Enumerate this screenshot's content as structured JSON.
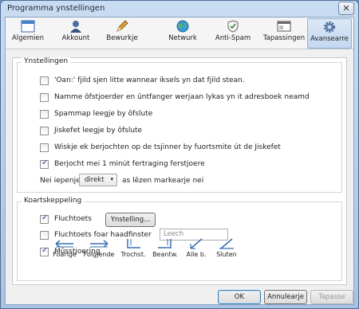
{
  "window": {
    "title": "Programma ynstellingen",
    "close_glyph": "✕"
  },
  "toolbar": [
    {
      "name": "algemien",
      "label": "Algemien",
      "icon": "window-icon",
      "active": false
    },
    {
      "name": "akkount",
      "label": "Akkount",
      "icon": "person-icon",
      "active": false
    },
    {
      "name": "bewurkje",
      "label": "Bewurkje",
      "icon": "pencil-icon",
      "active": false
    },
    {
      "name": "netwurk",
      "label": "Netwurk",
      "icon": "globe-icon",
      "active": false
    },
    {
      "name": "anti-spam",
      "label": "Anti-Spam",
      "icon": "shield-icon",
      "active": false
    },
    {
      "name": "tapassingen",
      "label": "Tapassingen",
      "icon": "app-icon",
      "active": false
    },
    {
      "name": "avansearre",
      "label": "Avansearre",
      "icon": "gear-icon",
      "active": true
    }
  ],
  "settings": {
    "legend": "Ynstellingen",
    "options": [
      {
        "label": "'Oan:' fjild sjen litte wannear iksels yn dat fjild stean.",
        "checked": false
      },
      {
        "label": "Namme ôfstjoerder en ûntfanger werjaan lykas yn it adresboek neamd",
        "checked": false
      },
      {
        "label": "Spammap leegje by ôfslute",
        "checked": false
      },
      {
        "label": "Jiskefet leegje by ôfslute",
        "checked": false
      },
      {
        "label": "Wiskje ek berjochten op de tsjinner by fuortsmite út de Jiskefet",
        "checked": false
      },
      {
        "label": "Berjocht mei 1 minút fertraging ferstjoere",
        "checked": true
      }
    ],
    "open_prefix": "Nei iepenje",
    "open_value": "direkt",
    "open_suffix": "as lêzen markearje nei"
  },
  "shortcuts": {
    "legend": "Koartskeppeling",
    "fluchtoets": {
      "label": "Fluchtoets",
      "checked": true
    },
    "ynstelling_button": "Ynstelling...",
    "foar_haadfinster": {
      "label": "Fluchtoets foar haadfinster",
      "checked": false
    },
    "leech_placeholder": "Leech",
    "mustsjoering": {
      "label": "Mûsstjoering",
      "checked": true
    },
    "gestures": [
      {
        "name": "foarige",
        "label": "Foarige",
        "icon": "arrow-left-icon"
      },
      {
        "name": "folgjende",
        "label": "Folgjende",
        "icon": "arrow-right-icon"
      },
      {
        "name": "trochst",
        "label": "Trochst.",
        "icon": "arrow-down-left-icon"
      },
      {
        "name": "beantw",
        "label": "Beantw.",
        "icon": "arrow-down-right-icon"
      },
      {
        "name": "alle-b",
        "label": "Alle b.",
        "icon": "arrow-diagonal-icon"
      },
      {
        "name": "sluten",
        "label": "Sluten",
        "icon": "arrow-close-icon"
      }
    ]
  },
  "buttons": {
    "ok": "OK",
    "cancel": "Annulearje",
    "apply": "Tapasse"
  }
}
